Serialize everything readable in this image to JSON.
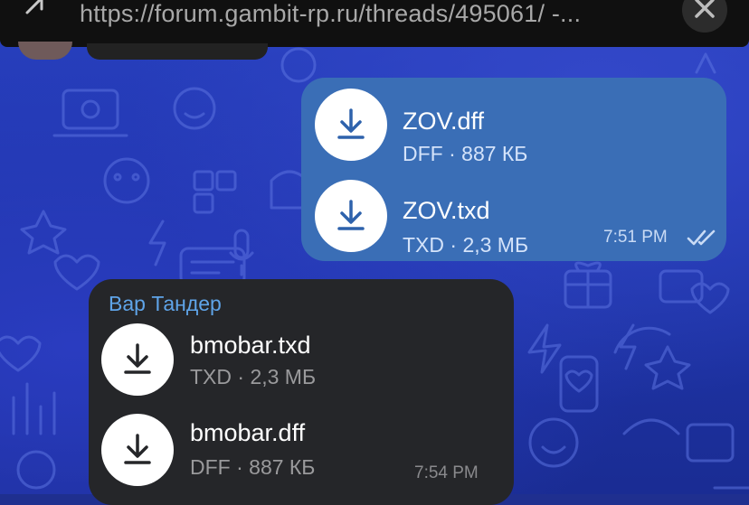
{
  "browser": {
    "url": "https://forum.gambit-rp.ru/threads/495061/ -..."
  },
  "chat": {
    "outgoing": {
      "files": [
        {
          "name": "ZOV.dff",
          "meta": "DFF · 887 КБ"
        },
        {
          "name": "ZOV.txd",
          "meta": "TXD · 2,3 МБ"
        }
      ],
      "time": "7:51 PM",
      "status": "read"
    },
    "incoming": {
      "sender": "Вар Тандер",
      "files": [
        {
          "name": "bmobar.txd",
          "meta": "TXD · 2,3 МБ"
        },
        {
          "name": "bmobar.dff",
          "meta": "DFF · 887 КБ"
        }
      ],
      "time": "7:54 PM"
    }
  },
  "colors": {
    "outgoing_bubble": "#3a6eb6",
    "incoming_bubble": "#252629",
    "sender_name": "#5fa4e8",
    "background": "#2840c0"
  },
  "icons": {
    "download": "download-arrow-icon",
    "read_receipt": "double-check-icon",
    "close": "close-icon",
    "collapse": "collapse-arrow-icon"
  }
}
